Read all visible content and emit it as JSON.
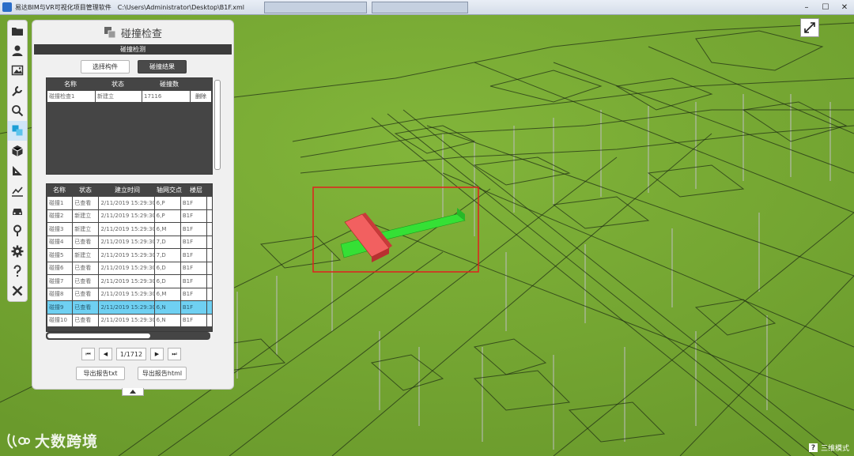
{
  "window": {
    "title": "易达BIM与VR可视化项目管理软件",
    "path": "C:\\Users\\Administrator\\Desktop\\B1F.xml",
    "controls": [
      "–",
      "☐",
      "✕"
    ]
  },
  "panel": {
    "title": "碰撞检查",
    "section": "碰撞检测",
    "select_button": "选择构件",
    "result_button": "碰撞结果",
    "top_table": {
      "headers": [
        "名称",
        "状态",
        "碰撞数"
      ],
      "row": [
        "碰撞检查1",
        "新建立",
        "17116",
        "删除"
      ]
    },
    "bottom_table": {
      "headers": [
        "名称",
        "状态",
        "建立时间",
        "轴网交点",
        "楼层"
      ],
      "rows": [
        [
          "碰撞1",
          "已查看",
          "2/11/2019 15:29:30",
          "6,P",
          "B1F"
        ],
        [
          "碰撞2",
          "新建立",
          "2/11/2019 15:29:30",
          "6,P",
          "B1F"
        ],
        [
          "碰撞3",
          "新建立",
          "2/11/2019 15:29:30",
          "6,M",
          "B1F"
        ],
        [
          "碰撞4",
          "已查看",
          "2/11/2019 15:29:30",
          "7,D",
          "B1F"
        ],
        [
          "碰撞5",
          "新建立",
          "2/11/2019 15:29:30",
          "7,D",
          "B1F"
        ],
        [
          "碰撞6",
          "已查看",
          "2/11/2019 15:29:30",
          "6,D",
          "B1F"
        ],
        [
          "碰撞7",
          "已查看",
          "2/11/2019 15:29:30",
          "6,D",
          "B1F"
        ],
        [
          "碰撞8",
          "已查看",
          "2/11/2019 15:29:30",
          "6,M",
          "B1F"
        ],
        [
          "碰撞9",
          "已查看",
          "2/11/2019 15:29:30",
          "6,N",
          "B1F"
        ],
        [
          "碰撞10",
          "已查看",
          "2/11/2019 15:29:30",
          "6,N",
          "B1F"
        ]
      ],
      "selected_row": 8
    },
    "pager": {
      "first": "⏮",
      "prev": "◀",
      "info": "1/1712",
      "next": "▶",
      "last": "⏭"
    },
    "export_txt": "导出报告txt",
    "export_html": "导出报告html"
  },
  "viewport": {
    "mode_label": "三维模式",
    "mode_icon": "?",
    "watermark": "大数跨境",
    "ground_color": "#74a632",
    "highlight_color": "#e0201e"
  }
}
